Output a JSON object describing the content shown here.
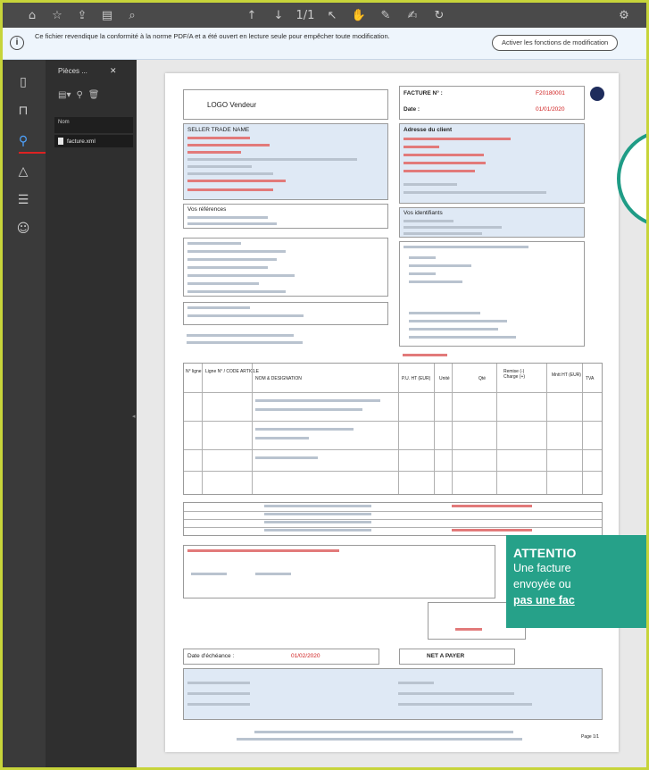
{
  "notice": {
    "text": "Ce fichier revendique la conformité à la norme PDF/A et a été ouvert en lecture seule pour empêcher toute modification.",
    "button_label": "Activer les fonctions de modification"
  },
  "attachments_panel": {
    "title": "Pièces ...",
    "close_label": "✕",
    "column_header": "Nom",
    "items": [
      {
        "label": "facture.xml"
      }
    ]
  },
  "invoice": {
    "logo_text": "LOGO Vendeur",
    "invoice_no_label": "FACTURE N° :",
    "invoice_no_value": "F20180001",
    "date_label": "Date :",
    "date_value": "01/01/2020",
    "seller_name": "SELLER TRADE NAME",
    "buyer_address_label": "Adresse du client",
    "refs_label": "Vos références",
    "vos_identifiants_label": "Vos identifiants",
    "line_headers": [
      "N° ligne",
      "Ligne N° / CODE ARTICLE",
      "NOM & DESIGNATION",
      "P.U. HT (EUR)",
      "Unité",
      "Qté",
      "Remise (-) Charge (+)",
      "Mntt HT (EUR)",
      "TVA"
    ],
    "date_echeance_label": "Date d'échéance :",
    "date_echeance_value": "01/02/2020",
    "net_a_payer_label": "NET A PAYER",
    "footer_text": "Page 1/1"
  },
  "callout": {
    "title": "ATTENTIO",
    "line1": "Une facture",
    "line2": "envoyée ou",
    "line3": "pas une fac"
  },
  "colors": {
    "accent_teal": "#26a189",
    "frame_border": "#c7d43a",
    "toolbar_bg": "#4a4a4a",
    "notice_bg": "#eef5fc"
  }
}
